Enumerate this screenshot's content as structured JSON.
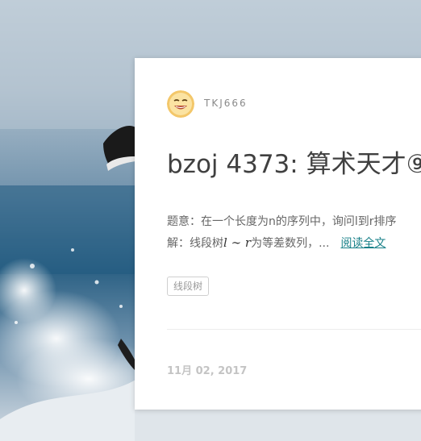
{
  "post": {
    "author": "TKJ666",
    "title": "bzoj 4373: 算术天才⑨-",
    "excerpt_line1": "题意：在一个长度为n的序列中，询问l到r排序",
    "excerpt_line2_prefix": "解：线段树",
    "excerpt_math": "l ∼ r",
    "excerpt_line2_suffix": "为等差数列，...",
    "read_more": "阅读全文",
    "tag": "线段树",
    "date": "11月 02, 2017"
  },
  "icons": {
    "avatar": "smiley-avatar-icon"
  }
}
